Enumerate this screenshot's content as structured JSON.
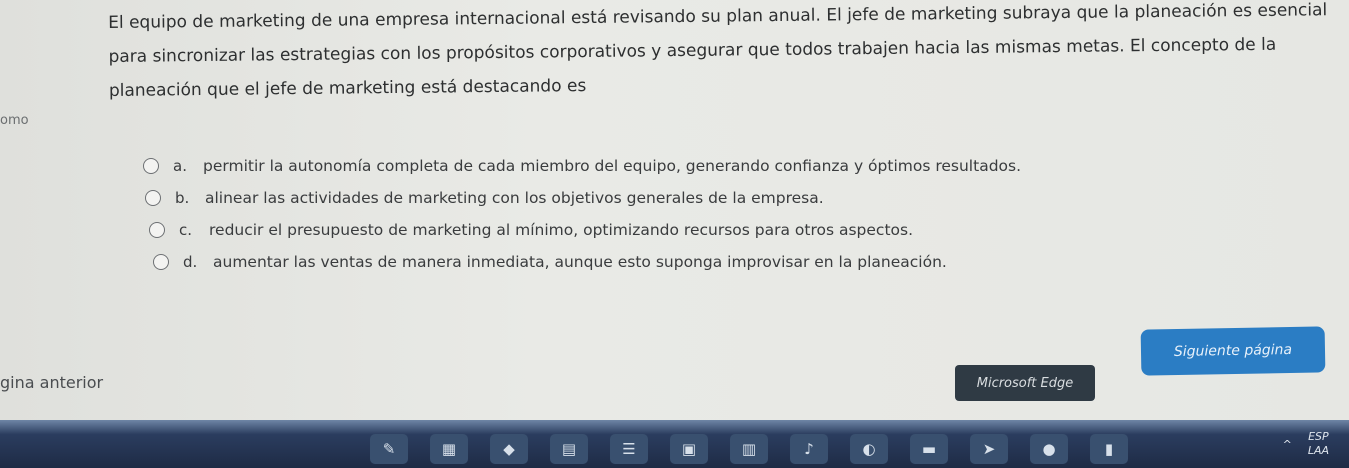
{
  "question": {
    "text": "El equipo de marketing de una empresa internacional está revisando su plan anual. El jefe de marketing subraya que la planeación es esencial para sincronizar las estrategias con los propósitos corporativos y asegurar que todos trabajen hacia las mismas metas. El concepto de la planeación que el jefe de marketing está destacando es"
  },
  "left_fragment": "omo",
  "options": [
    {
      "letter": "a.",
      "text": "permitir la autonomía completa de cada miembro del equipo, generando confianza y óptimos resultados."
    },
    {
      "letter": "b.",
      "text": "alinear las actividades de marketing con los objetivos generales de la empresa."
    },
    {
      "letter": "c.",
      "text": "reducir el presupuesto de marketing al mínimo, optimizando recursos para otros aspectos."
    },
    {
      "letter": "d.",
      "text": "aumentar las ventas de manera inmediata, aunque esto suponga improvisar en la planeación."
    }
  ],
  "navigation": {
    "prev_label": "gina anterior",
    "next_label": "Siguiente página"
  },
  "tooltip": "Microsoft Edge",
  "taskbar": {
    "tray_lang_top": "ESP",
    "tray_lang_bottom": "LAA",
    "chevron": "^"
  }
}
